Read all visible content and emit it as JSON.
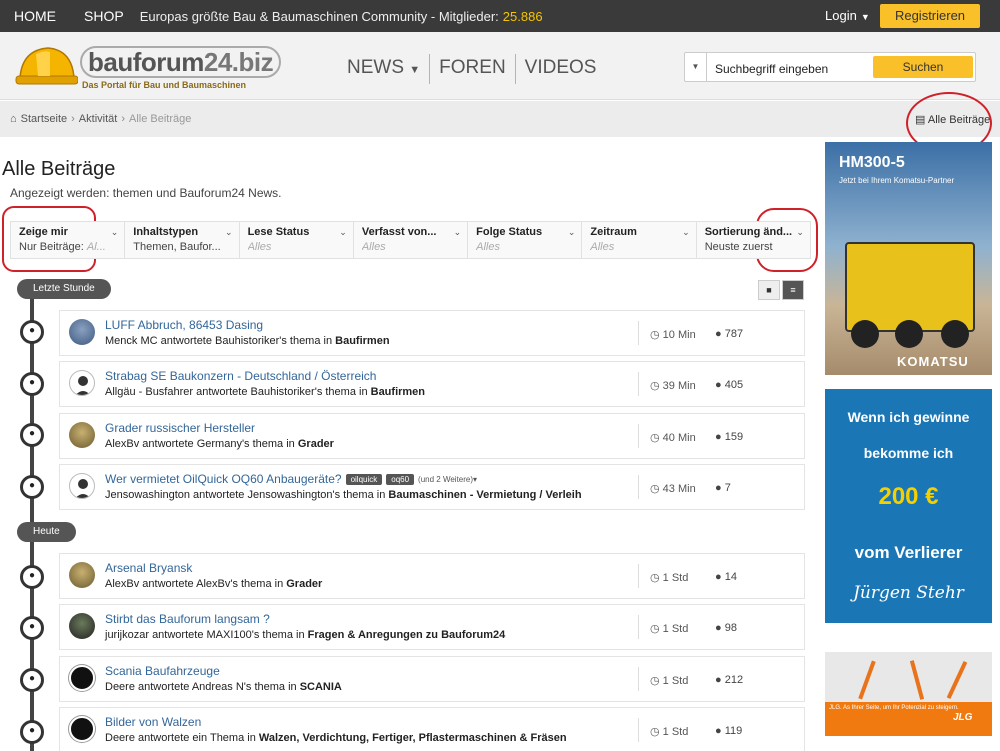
{
  "topbar": {
    "home": "HOME",
    "shop": "SHOP",
    "tagline": "Europas größte Bau & Baumaschinen Community - Mitglieder:",
    "members": "25.886",
    "login": "Login",
    "register": "Registrieren"
  },
  "logo": {
    "brand_main": "bauforum",
    "brand_suffix": "24.biz",
    "subtitle": "Das Portal für Bau und Baumaschinen"
  },
  "nav": {
    "news": "NEWS",
    "forums": "FOREN",
    "videos": "VIDEOS"
  },
  "search": {
    "placeholder": "Suchbegriff eingeben",
    "button": "Suchen"
  },
  "breadcrumb": {
    "home": "Startseite",
    "activity": "Aktivität",
    "current": "Alle Beiträge",
    "right_link": "Alle Beiträge"
  },
  "page": {
    "title": "Alle Beiträge",
    "subtitle": "Angezeigt werden: themen und Bauforum24 News."
  },
  "filters": [
    {
      "label": "Zeige mir",
      "value": "Nur Beiträge:",
      "placeholder": "Al..."
    },
    {
      "label": "Inhaltstypen",
      "value": "Themen, Baufor...",
      "placeholder": ""
    },
    {
      "label": "Lese Status",
      "value": "",
      "placeholder": "Alles"
    },
    {
      "label": "Verfasst von...",
      "value": "",
      "placeholder": "Alles"
    },
    {
      "label": "Folge Status",
      "value": "",
      "placeholder": "Alles"
    },
    {
      "label": "Zeitraum",
      "value": "",
      "placeholder": "Alles"
    },
    {
      "label": "Sortierung änd...",
      "value": "Neuste zuerst",
      "placeholder": ""
    }
  ],
  "phases": {
    "last_hour": "Letzte Stunde",
    "today": "Heute"
  },
  "posts": [
    {
      "title": "LUFF Abbruch, 86453 Dasing",
      "meta_prefix": "Menck MC antwortete Bauhistoriker's thema in ",
      "forum": "Baufirmen",
      "time": "10 Min",
      "replies": "787"
    },
    {
      "title": "Strabag SE Baukonzern - Deutschland / Österreich",
      "meta_prefix": "Allgäu - Busfahrer antwortete Bauhistoriker's thema in ",
      "forum": "Baufirmen",
      "time": "39 Min",
      "replies": "405"
    },
    {
      "title": "Grader russischer Hersteller",
      "meta_prefix": "AlexBv antwortete Germany's thema in ",
      "forum": "Grader",
      "time": "40 Min",
      "replies": "159"
    },
    {
      "title": "Wer vermietet OilQuick OQ60 Anbaugeräte?",
      "meta_prefix": "Jensowashington antwortete Jensowashington's thema in ",
      "forum": "Baumaschinen - Vermietung / Verleih",
      "time": "43 Min",
      "replies": "7",
      "tags": [
        "oilquick",
        "oq60"
      ],
      "more_tags": "(und 2 Weitere)"
    },
    {
      "title": "Arsenal Bryansk",
      "meta_prefix": "AlexBv antwortete AlexBv's thema in ",
      "forum": "Grader",
      "time": "1 Std",
      "replies": "14"
    },
    {
      "title": "Stirbt das Bauforum langsam ?",
      "meta_prefix": "jurijkozar antwortete MAXI100's thema in ",
      "forum": "Fragen & Anregungen zu Bauforum24",
      "time": "1 Std",
      "replies": "98"
    },
    {
      "title": "Scania Baufahrzeuge",
      "meta_prefix": "Deere antwortete Andreas N's thema in ",
      "forum": "SCANIA",
      "time": "1 Std",
      "replies": "212"
    },
    {
      "title": "Bilder von Walzen",
      "meta_prefix": "Deere antwortete ein Thema in ",
      "forum": "Walzen, Verdichtung, Fertiger, Pflastermaschinen & Fräsen",
      "time": "1 Std",
      "replies": "119"
    }
  ],
  "ads": {
    "komatsu_title": "HM300-5",
    "komatsu_sub": "Jetzt bei Ihrem Komatsu-Partner",
    "komatsu_brand": "KOMATSU",
    "bet_l1": "Wenn ich gewinne",
    "bet_l2": "bekomme ich",
    "bet_amount": "200 €",
    "bet_l4": "vom Verlierer",
    "bet_name": "Jürgen Stehr",
    "jlg_text": "JLG. As Ihrer Seite, um Ihr Potenzial zu steigern.",
    "jlg_brand": "JLG"
  },
  "colors": {
    "accent": "#f9c02a",
    "topbar": "#3a3a3a",
    "link": "#336699",
    "annotation": "#d0202a"
  }
}
